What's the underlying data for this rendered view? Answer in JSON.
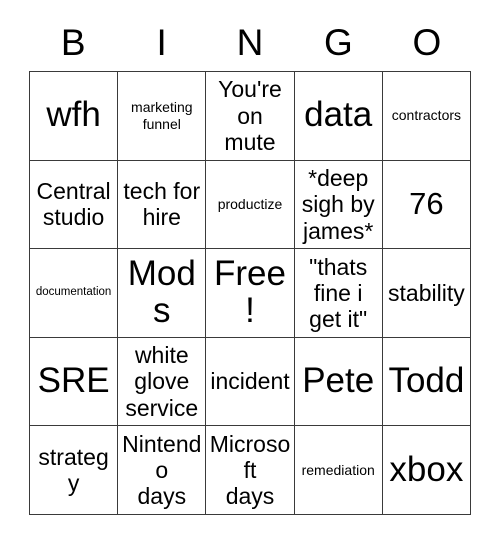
{
  "card": {
    "title": "BINGO",
    "header_letters": [
      "B",
      "I",
      "N",
      "G",
      "O"
    ],
    "border_color": "#3a3a3a",
    "background_color": "#ffffff",
    "text_color": "#000000",
    "rows": 5,
    "columns": 5,
    "cells": [
      {
        "text": "wfh",
        "size": "xl"
      },
      {
        "text": "marketing\nfunnel",
        "size": "xs"
      },
      {
        "text": "You're\non\nmute",
        "size": "md"
      },
      {
        "text": "data",
        "size": "xl"
      },
      {
        "text": "contractors",
        "size": "xs"
      },
      {
        "text": "Central\nstudio",
        "size": "md"
      },
      {
        "text": "tech for\nhire",
        "size": "md"
      },
      {
        "text": "productize",
        "size": "xs"
      },
      {
        "text": "*deep\nsigh by\njames*",
        "size": "md"
      },
      {
        "text": "76",
        "size": "lg"
      },
      {
        "text": "documentation",
        "size": "xxs"
      },
      {
        "text": "Mods",
        "size": "xl"
      },
      {
        "text": "Free!",
        "size": "xl"
      },
      {
        "text": "\"thats\nfine i\nget it\"",
        "size": "md"
      },
      {
        "text": "stability",
        "size": "md"
      },
      {
        "text": "SRE",
        "size": "xl"
      },
      {
        "text": "white\nglove\nservice",
        "size": "md"
      },
      {
        "text": "incident",
        "size": "md"
      },
      {
        "text": "Pete",
        "size": "xl"
      },
      {
        "text": "Todd",
        "size": "xl"
      },
      {
        "text": "strategy",
        "size": "md"
      },
      {
        "text": "Nintendo\ndays",
        "size": "md"
      },
      {
        "text": "Microsoft\ndays",
        "size": "md"
      },
      {
        "text": "remediation",
        "size": "xs"
      },
      {
        "text": "xbox",
        "size": "xl"
      }
    ]
  }
}
